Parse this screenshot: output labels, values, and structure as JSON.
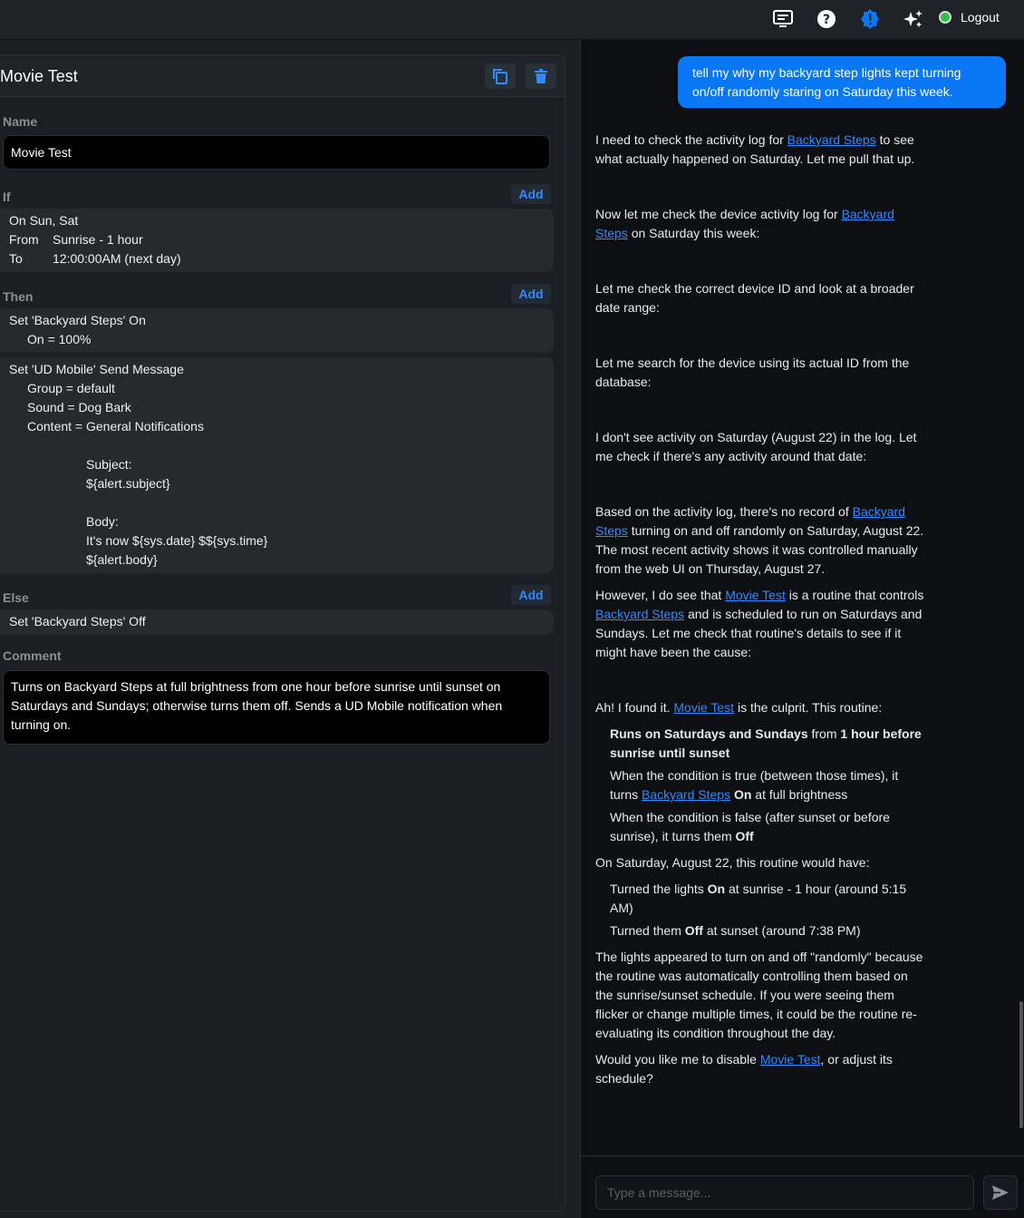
{
  "topbar": {
    "logout_label": "Logout"
  },
  "routine": {
    "title": "Movie Test",
    "name_label": "Name",
    "name_value": "Movie Test",
    "if_label": "If",
    "then_label": "Then",
    "else_label": "Else",
    "comment_label": "Comment",
    "add_label": "Add",
    "if_lines": {
      "on": "On Sun, Sat",
      "from_key": "From",
      "from_val": "Sunrise - 1 hour",
      "to_key": "To",
      "to_val": "12:00:00AM (next day)"
    },
    "then_actions": {
      "a1_title": "Set 'Backyard Steps' On",
      "a1_l1": "On = 100%",
      "a2_title": "Set 'UD Mobile' Send Message",
      "a2_l1": "Group = default",
      "a2_l2": "Sound = Dog Bark",
      "a2_l3": "Content = General Notifications",
      "a2_subject_label": "Subject:",
      "a2_subject_val": "${alert.subject}",
      "a2_body_label": "Body:",
      "a2_body_l1": "It's now ${sys.date} $${sys.time}",
      "a2_body_l2": "${alert.body}"
    },
    "else_action": "Set 'Backyard Steps' Off",
    "comment": "Turns on Backyard Steps at full brightness from one hour before sunrise until sunset on Saturdays and Sundays; otherwise turns them off. Sends a UD Mobile notification when turning on."
  },
  "chat": {
    "user_message": "tell my why my backyard step lights kept turning on/off randomly staring on Saturday this week.",
    "link_device": "Backyard Steps",
    "link_device_p1": "Backyard",
    "link_device_p2": "Steps",
    "link_routine": "Movie Test",
    "m1_a": "I need to check the activity log for ",
    "m1_b": " to see what actually happened on Saturday. Let me pull that up.",
    "m2_a": "Now let me check the device activity log for ",
    "m2_b": " on Saturday this week:",
    "m3": "Let me check the correct device ID and look at a broader date range:",
    "m4": "Let me search for the device using its actual ID from the database:",
    "m5": "I don't see activity on Saturday (August 22) in the log. Let me check if there's any activity around that date:",
    "m6_a": "Based on the activity log, there's no record of ",
    "m6_b": " turning on and off randomly on Saturday, August 22. The most recent activity shows it was controlled manually from the web UI on Thursday, August 27.",
    "m7_a": "However, I do see that ",
    "m7_b": " is a routine that controls ",
    "m7_c": " and is scheduled to run on Saturdays and Sundays. Let me check that routine's details to see if it might have been the cause:",
    "m8_a": "Ah! I found it. ",
    "m8_b": " is the culprit. This routine:",
    "b1_bold1": "Runs on Saturdays and Sundays",
    "b1_mid": " from ",
    "b1_bold2": "1 hour before sunrise until sunset",
    "b2_a": "When the condition is true (between those times), it turns ",
    "b2_bold": "On",
    "b2_c": " at full brightness",
    "b3_a": "When the condition is false (after sunset or before sunrise), it turns them ",
    "b3_bold": "Off",
    "m9": "On Saturday, August 22, this routine would have:",
    "c1_a": "Turned the lights ",
    "c1_bold": "On",
    "c1_b": " at sunrise - 1 hour (around 5:15 AM)",
    "c2_a": "Turned them ",
    "c2_bold": "Off",
    "c2_b": " at sunset (around 7:38 PM)",
    "m10": "The lights appeared to turn on and off \"randomly\" because the routine was automatically controlling them based on the sunrise/sunset schedule. If you were seeing them flicker or change multiple times, it could be the routine re-evaluating its condition throughout the day.",
    "m11_a": "Would you like me to disable ",
    "m11_b": ", or adjust its schedule?",
    "input_placeholder": "Type a message..."
  }
}
